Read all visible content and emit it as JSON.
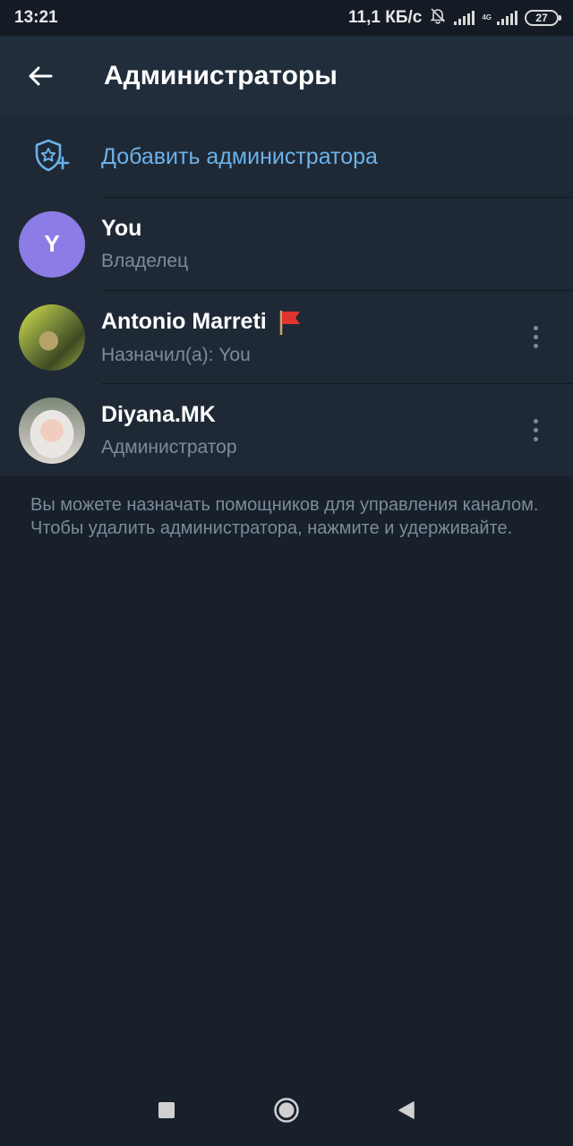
{
  "status_bar": {
    "time": "13:21",
    "net_speed": "11,1 КБ/с",
    "net_type": "4G",
    "battery": "27"
  },
  "app_bar": {
    "title": "Администраторы"
  },
  "add_admin": {
    "label": "Добавить администратора",
    "icon": "shield-star-plus-icon"
  },
  "admins": [
    {
      "name": "You",
      "role": "Владелец",
      "avatar_letter": "Y",
      "avatar_color": "#8c7ce6"
    },
    {
      "name": "Antonio Marreti",
      "role": "Назначил(а): You",
      "badge": "red-flag-icon"
    },
    {
      "name": "Diyana.MK",
      "role": "Администратор"
    }
  ],
  "hint_text": "Вы можете назначать помощников для управления каналом. Чтобы удалить администратора, нажмите и удерживайте.",
  "colors": {
    "accent": "#6bb2ea",
    "background": "#17202b",
    "appbar": "#212d3b",
    "list_bg": "#1f2936",
    "secondary_text": "#7d8b99"
  }
}
